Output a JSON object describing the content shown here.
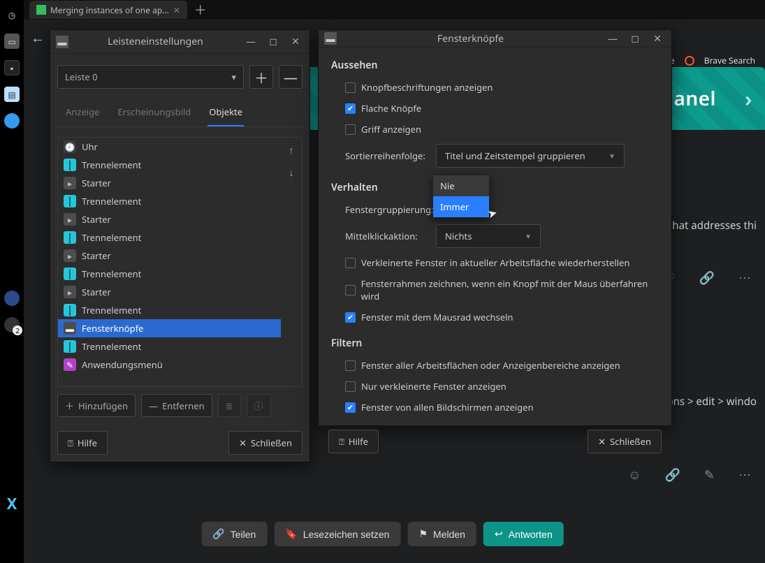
{
  "browser": {
    "tab_title": "Merging instances of one ap…",
    "right_label_1": "t Lite",
    "right_label_2": "Brave Search",
    "banner_text": "anel",
    "forum_line_1": "that addresses thi",
    "forum_line_2": "tons > edit > windo"
  },
  "actions": {
    "share": "Teilen",
    "bookmark": "Lesezeichen setzen",
    "flag": "Melden",
    "reply": "Antworten"
  },
  "dlg_panel": {
    "title": "Leisteneinstellungen",
    "panel_select": "Leiste 0",
    "tabs": {
      "display": "Anzeige",
      "appearance": "Erscheinungsbild",
      "items": "Objekte"
    },
    "items": [
      {
        "icon": "clock",
        "label": "Uhr"
      },
      {
        "icon": "sep",
        "label": "Trennelement"
      },
      {
        "icon": "start",
        "label": "Starter"
      },
      {
        "icon": "sep",
        "label": "Trennelement"
      },
      {
        "icon": "start",
        "label": "Starter"
      },
      {
        "icon": "sep",
        "label": "Trennelement"
      },
      {
        "icon": "start",
        "label": "Starter"
      },
      {
        "icon": "sep",
        "label": "Trennelement"
      },
      {
        "icon": "start",
        "label": "Starter"
      },
      {
        "icon": "sep",
        "label": "Trennelement"
      },
      {
        "icon": "task",
        "label": "Fensterknöpfe",
        "selected": true
      },
      {
        "icon": "sep",
        "label": "Trennelement"
      },
      {
        "icon": "menu",
        "label": "Anwendungsmenü"
      }
    ],
    "add": "Hinzufügen",
    "remove": "Entfernen",
    "help": "Hilfe",
    "close": "Schließen"
  },
  "dlg_task": {
    "title": "Fensterknöpfe",
    "sections": {
      "look": "Aussehen",
      "behavior": "Verhalten",
      "filter": "Filtern"
    },
    "look": {
      "show_labels": "Knopfbeschriftungen anzeigen",
      "flat_buttons": "Flache Knöpfe",
      "show_handle": "Griff anzeigen",
      "sort_label": "Sortierreihenfolge:",
      "sort_value": "Titel und Zeitstempel gruppieren"
    },
    "behavior": {
      "group_label": "Fenstergruppierung:",
      "middle_label": "Mittelklickaktion:",
      "middle_value": "Nichts",
      "restore": "Verkleinerte Fenster in aktueller Arbeitsfläche wiederherstellen",
      "draw_frame": "Fensterrahmen zeichnen, wenn ein Knopf mit der Maus überfahren wird",
      "wheel": "Fenster mit dem Mausrad wechseln"
    },
    "filter": {
      "all_ws": "Fenster aller Arbeitsflächen oder Anzeigenbereiche anzeigen",
      "only_min": "Nur verkleinerte Fenster anzeigen",
      "all_mon": "Fenster von allen Bildschirmen anzeigen"
    },
    "dropdown": {
      "never": "Nie",
      "always": "Immer"
    },
    "help": "Hilfe",
    "close": "Schließen"
  }
}
